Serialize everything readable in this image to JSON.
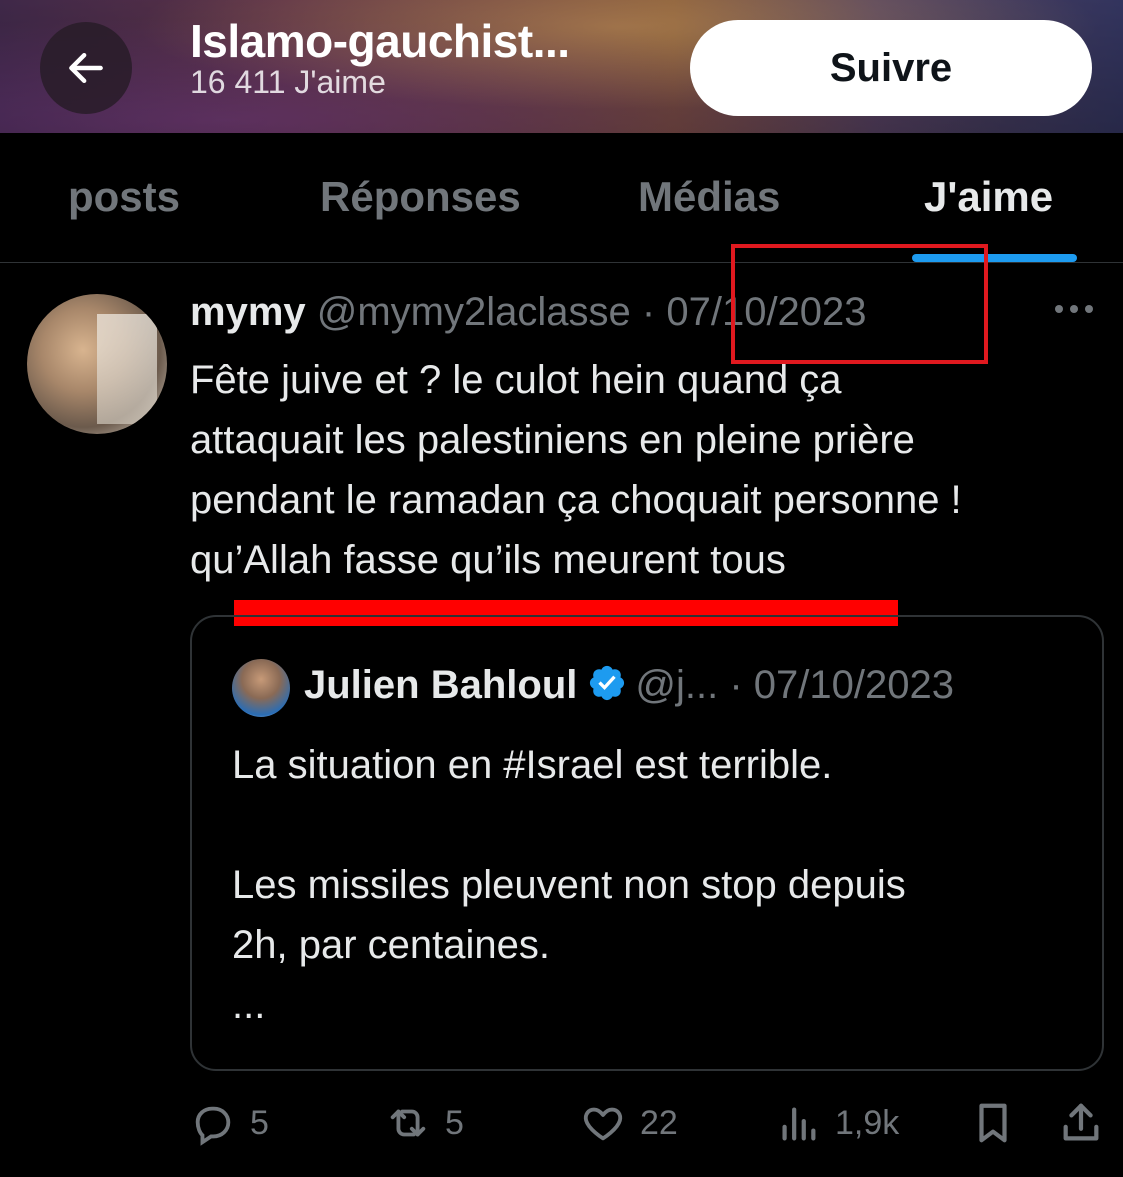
{
  "header": {
    "title": "Islamo-gauchist...",
    "subtitle": "16 411 J'aime",
    "follow_label": "Suivre"
  },
  "tabs": [
    {
      "label": "posts",
      "active": false
    },
    {
      "label": "Réponses",
      "active": false
    },
    {
      "label": "Médias",
      "active": false
    },
    {
      "label": "J'aime",
      "active": true
    }
  ],
  "tweet": {
    "name": "mymy",
    "handle": "@mymy2laclasse",
    "separator": "·",
    "date": "07/10/2023",
    "text_lines": [
      "Fête juive et ? le culot hein quand ça",
      "attaquait les palestiniens en pleine prière",
      "pendant le ramadan ça choquait personne !",
      "qu’Allah fasse qu’ils meurent tous"
    ]
  },
  "quote": {
    "name": "Julien Bahloul",
    "handle": "@j...",
    "separator": "·",
    "date": "07/10/2023",
    "text_lines": [
      "La situation en #Israel est terrible.",
      "",
      "Les missiles pleuvent non stop depuis",
      "2h, par centaines.",
      "..."
    ]
  },
  "actions": {
    "replies": "5",
    "reposts": "5",
    "likes": "22",
    "views": "1,9k"
  },
  "colors": {
    "accent": "#1d9bf0",
    "annotation_red": "#ff0000",
    "muted_text": "#71767b"
  }
}
